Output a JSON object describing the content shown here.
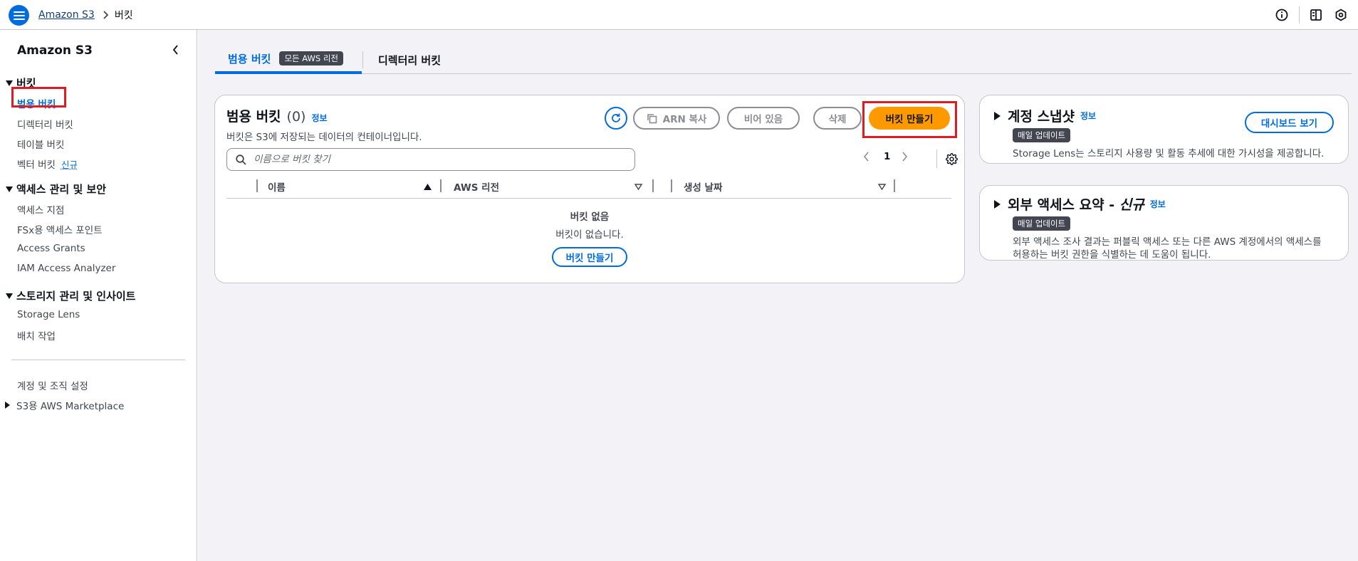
{
  "breadcrumb": {
    "root": "Amazon S3",
    "current": "버킷"
  },
  "sidebar": {
    "title": "Amazon S3",
    "sections": [
      {
        "label": "버킷",
        "items": [
          "범용 버킷",
          "디렉터리 버킷",
          "테이블 버킷",
          "벡터 버킷"
        ],
        "new_badge": "신규"
      },
      {
        "label": "액세스 관리 및 보안",
        "items": [
          "액세스 지점",
          "FSx용 액세스 포인트",
          "Access Grants",
          "IAM Access Analyzer"
        ]
      },
      {
        "label": "스토리지 관리 및 인사이트",
        "items": [
          "Storage Lens",
          "배치 작업"
        ]
      }
    ],
    "footer_items": [
      "계정 및 조직 설정",
      "S3용 AWS Marketplace"
    ]
  },
  "tabs": [
    {
      "label": "범용 버킷",
      "badge": "모든 AWS 리전"
    },
    {
      "label": "디렉터리 버킷"
    }
  ],
  "buckets_panel": {
    "title": "범용 버킷",
    "count": "(0)",
    "info": "정보",
    "description": "버킷은 S3에 저장되는 데이터의 컨테이너입니다.",
    "buttons": {
      "copy_arn": "ARN 복사",
      "empty": "비어 있음",
      "delete": "삭제",
      "create": "버킷 만들기"
    },
    "search_placeholder": "이름으로 버킷 찾기",
    "page": "1",
    "columns": [
      "이름",
      "AWS 리전",
      "생성 날짜"
    ],
    "empty_title": "버킷 없음",
    "empty_text": "버킷이 없습니다.",
    "empty_button": "버킷 만들기"
  },
  "snapshot_panel": {
    "title": "계정 스냅샷",
    "info": "정보",
    "badge": "매일 업데이트",
    "text": "Storage Lens는 스토리지 사용량 및 활동 추세에 대한 가시성을 제공합니다.",
    "button": "대시보드 보기"
  },
  "external_panel": {
    "title": "외부 액세스 요약 - ",
    "title_new": "신규",
    "info": "정보",
    "badge": "매일 업데이트",
    "text_line1": "외부 액세스 조사 결과는 퍼블릭 액세스 또는 다른 AWS 계정에서의 액세스를",
    "text_line2": "허용하는 버킷 권한을 식별하는 데 도움이 됩니다."
  },
  "colors": {
    "primary": "#006ce0",
    "action": "#ff9900",
    "highlight": "#e01b24"
  }
}
